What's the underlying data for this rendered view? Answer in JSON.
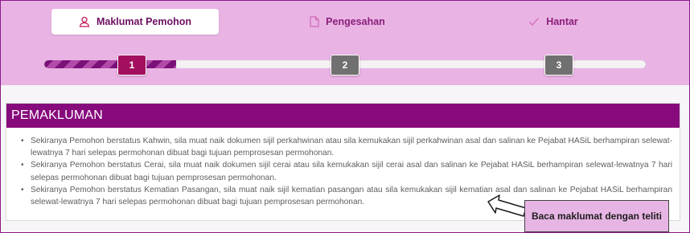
{
  "tabs": [
    {
      "label": "Maklumat Pemohon",
      "icon": "user-icon",
      "active": true
    },
    {
      "label": "Pengesahan",
      "icon": "document-icon",
      "active": false
    },
    {
      "label": "Hantar",
      "icon": "check-icon",
      "active": false
    }
  ],
  "progress": {
    "steps": [
      "1",
      "2",
      "3"
    ],
    "current_step": 1
  },
  "section": {
    "title": "PEMAKLUMAN",
    "notes": [
      "Sekiranya Pemohon berstatus Kahwin, sila muat naik dokumen sijil perkahwinan atau sila kemukakan sijil perkahwinan asal dan salinan ke Pejabat HASiL berhampiran selewat-lewatnya 7 hari selepas permohonan dibuat bagi tujuan pemprosesan permohonan.",
      "Sekiranya Pemohon berstatus Cerai, sila muat naik dokumen sijil cerai atau sila kemukakan sijil cerai asal dan salinan ke Pejabat HASiL berhampiran selewat-lewatnya 7 hari selepas permohonan dibuat bagi tujuan pemprosesan permohonan.",
      "Sekiranya Pemohon berstatus Kematian Pasangan, sila muat naik sijil kematian pasangan atau sila kemukakan sijil kematian asal dan salinan ke Pejabat HASiL berhampiran selewat-lewatnya 7 hari selepas permohonan dibuat bagi tujuan pemprosesan permohonan."
    ]
  },
  "callout": {
    "text": "Baca maklumat dengan teliti"
  },
  "colors": {
    "brand": "#870a7c",
    "band": "#e9b3e4",
    "step_active": "#a30f5e",
    "step_inactive": "#707070"
  }
}
